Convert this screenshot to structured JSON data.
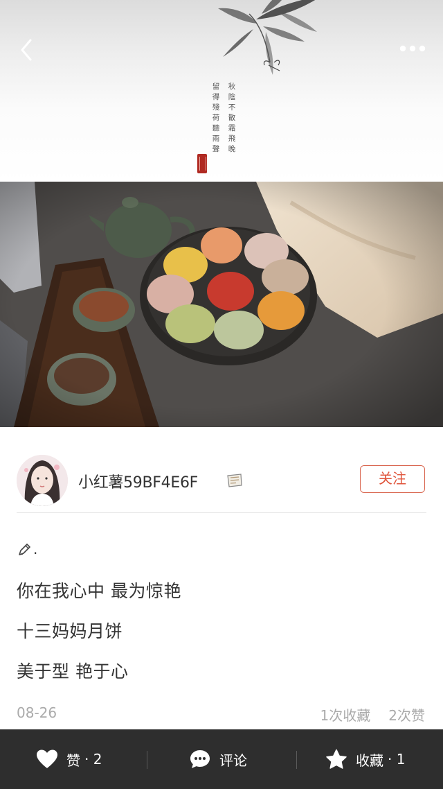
{
  "header": {
    "back_icon": "chevron-left-icon",
    "more_icon": "more-dots-icon",
    "poem_right": "秋陰不散霜飛晚",
    "poem_left": "留得殘荷聽雨聲"
  },
  "author": {
    "name": "小红薯59BF4E6F",
    "verify_icon": "note-badge-icon",
    "follow_label": "关注"
  },
  "post": {
    "lead_suffix": ".",
    "lines": [
      "你在我心中 最为惊艳",
      "十三妈妈月饼",
      "美于型 艳于心"
    ],
    "date": "08-26",
    "collect_count_text": "1次收藏",
    "like_count_text": "2次赞"
  },
  "bottom_bar": {
    "like_label": "赞",
    "like_count": "· 2",
    "comment_label": "评论",
    "collect_label": "收藏",
    "collect_count": "· 1"
  },
  "colors": {
    "accent": "#e0553c",
    "bar_bg": "#2e2e2e",
    "meta_text": "#aaaaaa"
  }
}
